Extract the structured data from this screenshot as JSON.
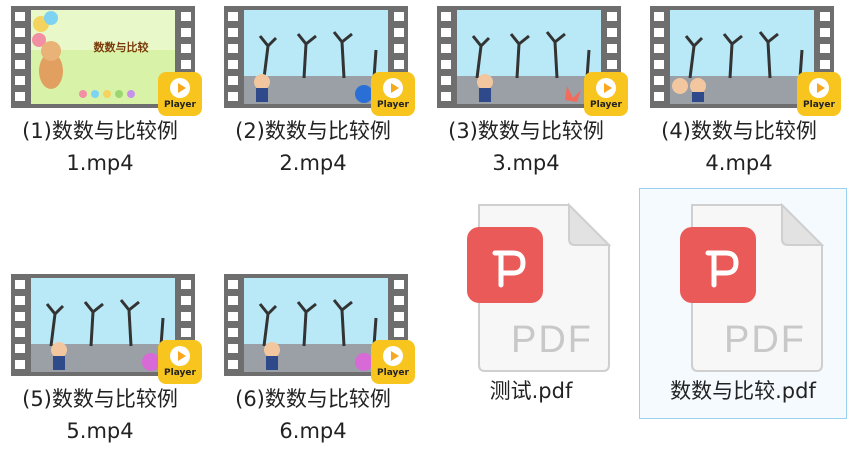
{
  "files": [
    {
      "name": "(1)数数与比较例\n1.mp4",
      "type": "video",
      "scene": "title",
      "title_text": "数数与比较",
      "badge": "Player"
    },
    {
      "name": "(2)数数与比较例\n2.mp4",
      "type": "video",
      "scene": "park",
      "badge": "Player"
    },
    {
      "name": "(3)数数与比较例\n3.mp4",
      "type": "video",
      "scene": "park",
      "badge": "Player"
    },
    {
      "name": "(4)数数与比较例\n4.mp4",
      "type": "video",
      "scene": "park",
      "badge": "Player"
    },
    {
      "name": "(5)数数与比较例\n5.mp4",
      "type": "video",
      "scene": "park",
      "badge": "Player"
    },
    {
      "name": "(6)数数与比较例\n6.mp4",
      "type": "video",
      "scene": "park",
      "badge": "Player"
    },
    {
      "name": "测试.pdf",
      "type": "pdf",
      "icon_text": "PDF"
    },
    {
      "name": "数数与比较.pdf",
      "type": "pdf",
      "icon_text": "PDF",
      "selected": true
    }
  ],
  "colors": {
    "film": "#6e6e6e",
    "badge": "#f7c51e",
    "pdf_red": "#ea5a58",
    "sky": "#b9e9f7",
    "selection_border": "#99d1f1"
  },
  "icons": {
    "video": "film-strip-icon",
    "player": "play-icon",
    "pdf": "pdf-file-icon"
  }
}
